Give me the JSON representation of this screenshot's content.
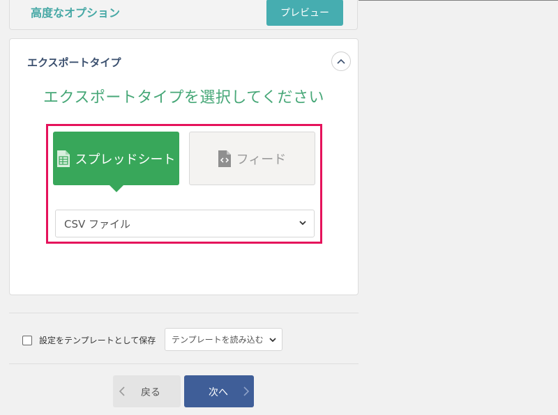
{
  "advanced": {
    "title": "高度なオプション",
    "preview_label": "プレビュー"
  },
  "export": {
    "title": "エクスポートタイプ",
    "heading": "エクスポートタイプを選択してください",
    "types": [
      {
        "label": "スプレッドシート",
        "icon": "spreadsheet-file-icon",
        "selected": true
      },
      {
        "label": "フィード",
        "icon": "code-file-icon",
        "selected": false
      }
    ],
    "format_value": "CSV ファイル"
  },
  "template": {
    "save_label": "設定をテンプレートとして保存",
    "load_value": "テンプレートを読み込む"
  },
  "nav": {
    "back_label": "戻る",
    "next_label": "次へ"
  },
  "colors": {
    "accent_teal": "#46adb0",
    "accent_green": "#38a75a",
    "highlight_red": "#e5125b",
    "primary_blue": "#3f5e98"
  }
}
